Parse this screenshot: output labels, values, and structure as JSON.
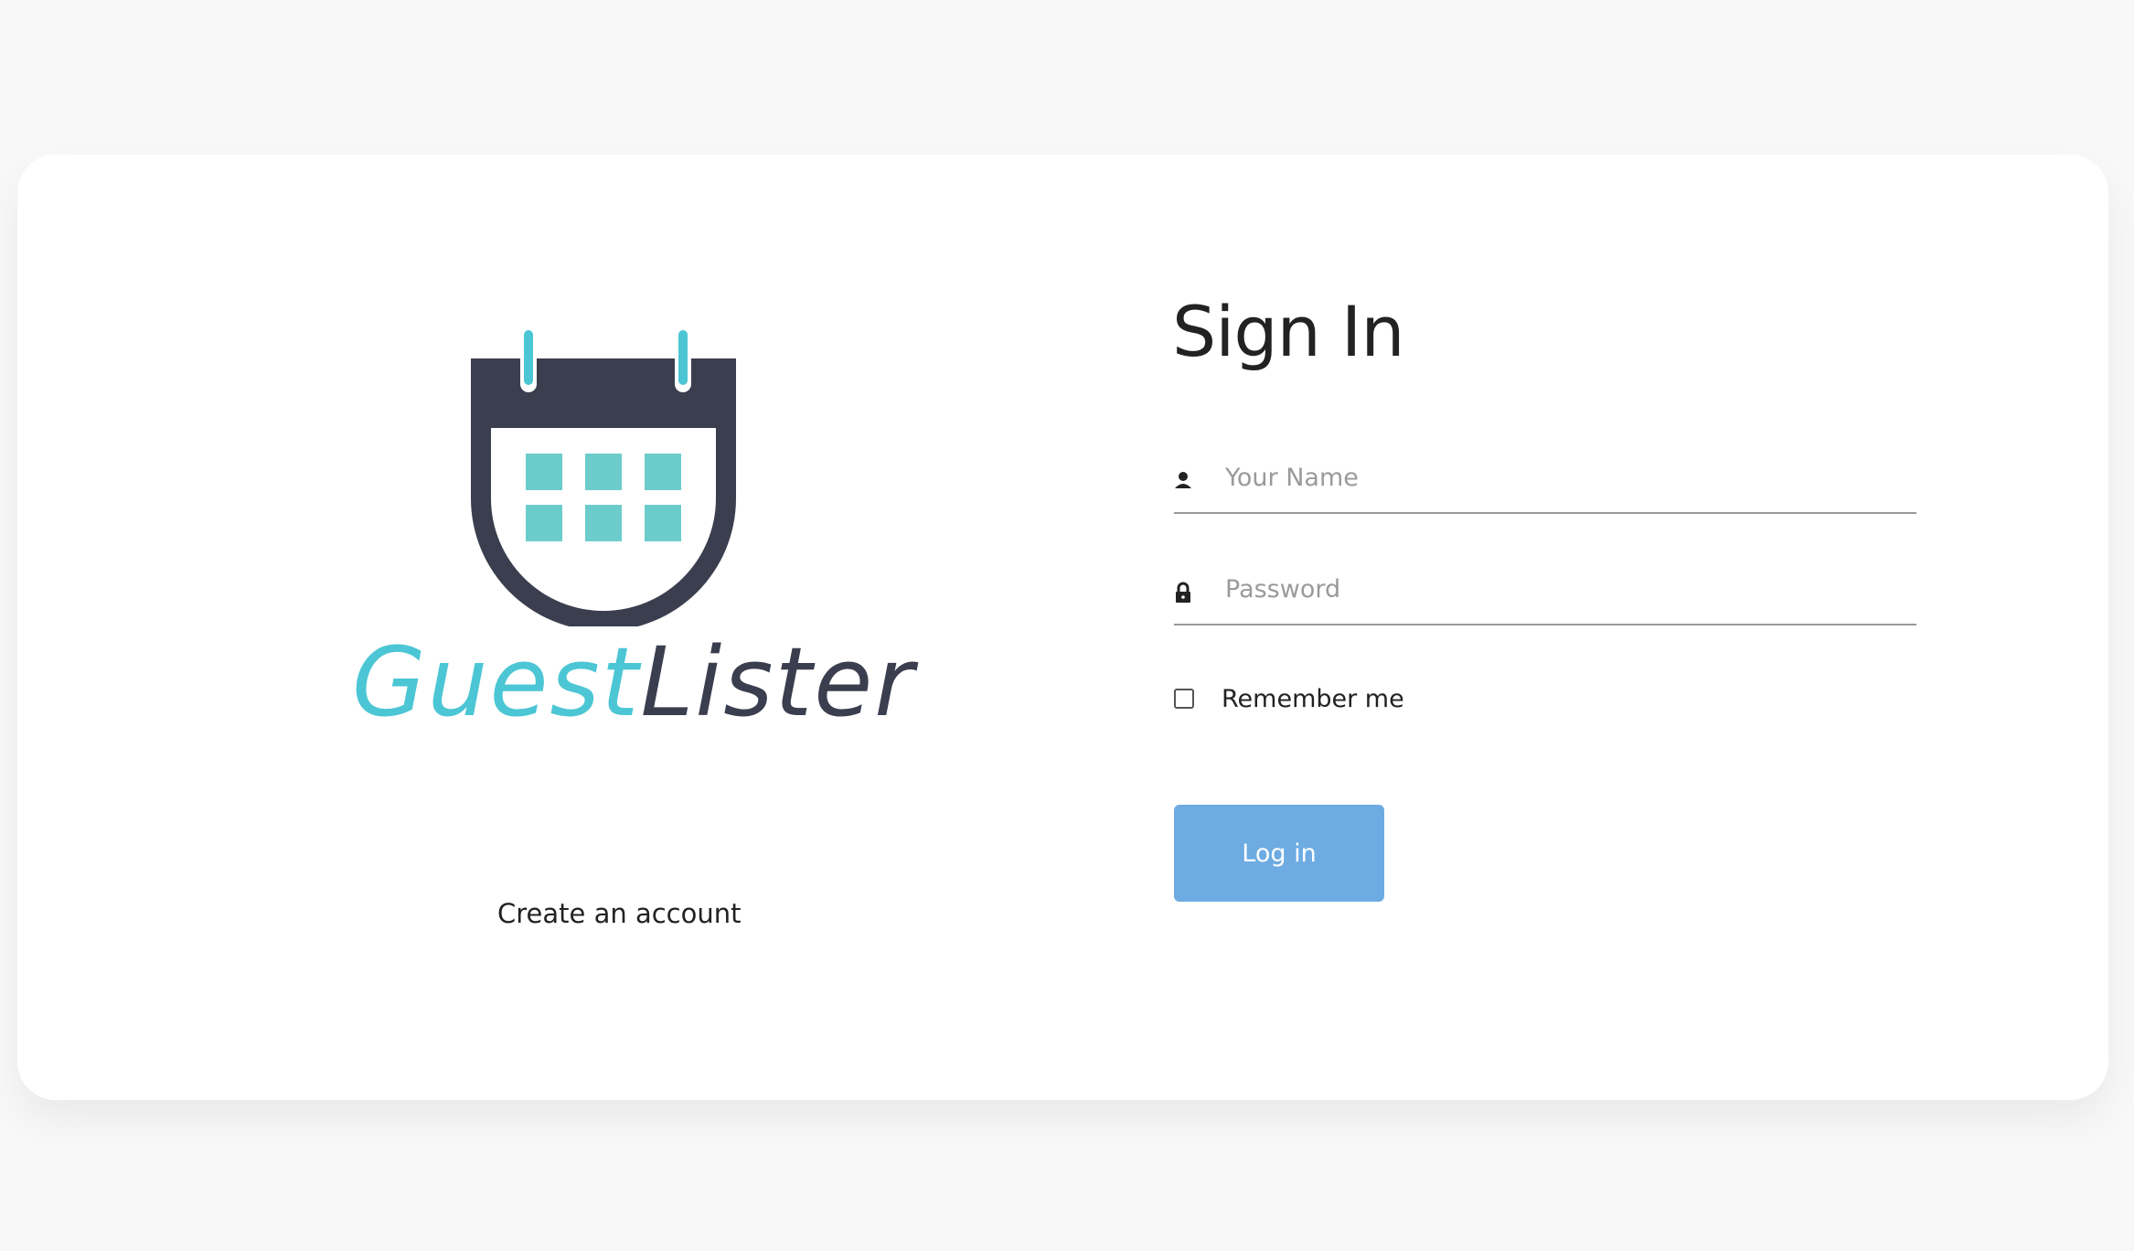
{
  "brand": {
    "name_part1": "Guest",
    "name_part2": "Lister",
    "colors": {
      "teal": "#4cc6d4",
      "teal_squares": "#6ccccc",
      "dark": "#3b3e4e"
    }
  },
  "links": {
    "create_account": "Create an account"
  },
  "signin": {
    "title": "Sign In",
    "name_field": {
      "icon": "person-icon",
      "placeholder": "Your Name",
      "value": ""
    },
    "password_field": {
      "icon": "lock-icon",
      "placeholder": "Password",
      "value": ""
    },
    "remember": {
      "label": "Remember me",
      "checked": false
    },
    "submit_label": "Log in",
    "submit_color": "#6dabe2"
  }
}
